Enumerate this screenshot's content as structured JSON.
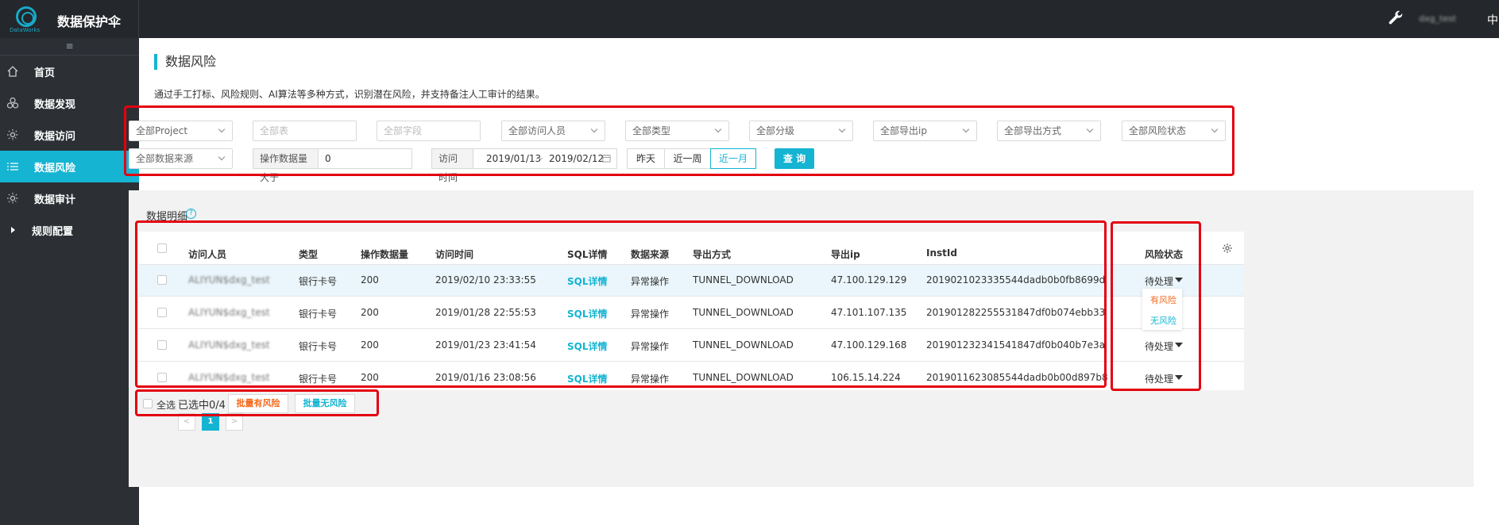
{
  "brand": {
    "logo_sub": "DataWorks",
    "title": "数据保护伞"
  },
  "topbar": {
    "user": "dxg_test",
    "lang": "中"
  },
  "sidebar": {
    "collapse": "≡",
    "items": [
      {
        "label": "首页",
        "icon": "home-icon"
      },
      {
        "label": "数据发现",
        "icon": "discover-icon"
      },
      {
        "label": "数据访问",
        "icon": "access-icon"
      },
      {
        "label": "数据风险",
        "icon": "list-icon",
        "active": true
      },
      {
        "label": "数据审计",
        "icon": "audit-icon"
      },
      {
        "label": "规则配置",
        "icon": "triangle-right-icon"
      }
    ]
  },
  "page": {
    "title": "数据风险",
    "desc": "通过手工打标、风险规则、AI算法等多种方式，识别潜在风险，并支持备注人工审计的结果。"
  },
  "filters": {
    "project": "全部Project",
    "table_placeholder": "全部表",
    "field_placeholder": "全部字段",
    "visitor": "全部访问人员",
    "type": "全部类型",
    "level": "全部分级",
    "export_ip": "全部导出ip",
    "export_method": "全部导出方式",
    "risk_status": "全部风险状态",
    "data_source": "全部数据来源",
    "op_count_label": "操作数据量大于",
    "op_count_value": "0",
    "visit_time_label": "访问时间",
    "date_start": "2019/01/13",
    "date_sep": "~",
    "date_end": "2019/02/12",
    "quick": [
      "昨天",
      "近一周",
      "近一月"
    ],
    "query_button": "查 询"
  },
  "detail": {
    "title": "数据明细",
    "help": "?",
    "columns": [
      "访问人员",
      "类型",
      "操作数据量",
      "访问时间",
      "SQL详情",
      "数据来源",
      "导出方式",
      "导出ip",
      "InstId",
      "风险状态"
    ],
    "rows": [
      {
        "user": "ALIYUN$dxg_test",
        "type": "银行卡号",
        "count": "200",
        "time": "2019/02/10 23:33:55",
        "sql": "SQL详情",
        "source": "异常操作",
        "method": "TUNNEL_DOWNLOAD",
        "ip": "47.100.129.129",
        "instid": "2019021023335544dadb0b0fb8699d",
        "status": "待处理"
      },
      {
        "user": "ALIYUN$dxg_test",
        "type": "银行卡号",
        "count": "200",
        "time": "2019/01/28 22:55:53",
        "sql": "SQL详情",
        "source": "异常操作",
        "method": "TUNNEL_DOWNLOAD",
        "ip": "47.101.107.135",
        "instid": "201901282255531847df0b074ebb33",
        "status": ""
      },
      {
        "user": "ALIYUN$dxg_test",
        "type": "银行卡号",
        "count": "200",
        "time": "2019/01/23 23:41:54",
        "sql": "SQL详情",
        "source": "异常操作",
        "method": "TUNNEL_DOWNLOAD",
        "ip": "47.100.129.168",
        "instid": "201901232341541847df0b040b7e3a",
        "status": "待处理"
      },
      {
        "user": "ALIYUN$dxg_test",
        "type": "银行卡号",
        "count": "200",
        "time": "2019/01/16 23:08:56",
        "sql": "SQL详情",
        "source": "异常操作",
        "method": "TUNNEL_DOWNLOAD",
        "ip": "106.15.14.224",
        "instid": "2019011623085544dadb0b00d897b8",
        "status": "待处理"
      }
    ],
    "risk_options": [
      "有风险",
      "无风险"
    ]
  },
  "bulk": {
    "select_all": "全选",
    "selected": "已选中0/4",
    "mark_risk": "批量有风险",
    "mark_no_risk": "批量无风险"
  },
  "pager": {
    "prev": "<",
    "page": "1",
    "next": ">"
  },
  "colors": {
    "accent": "#14b4d2",
    "risk": "#f46b1e",
    "highlight": "#e3000f"
  }
}
